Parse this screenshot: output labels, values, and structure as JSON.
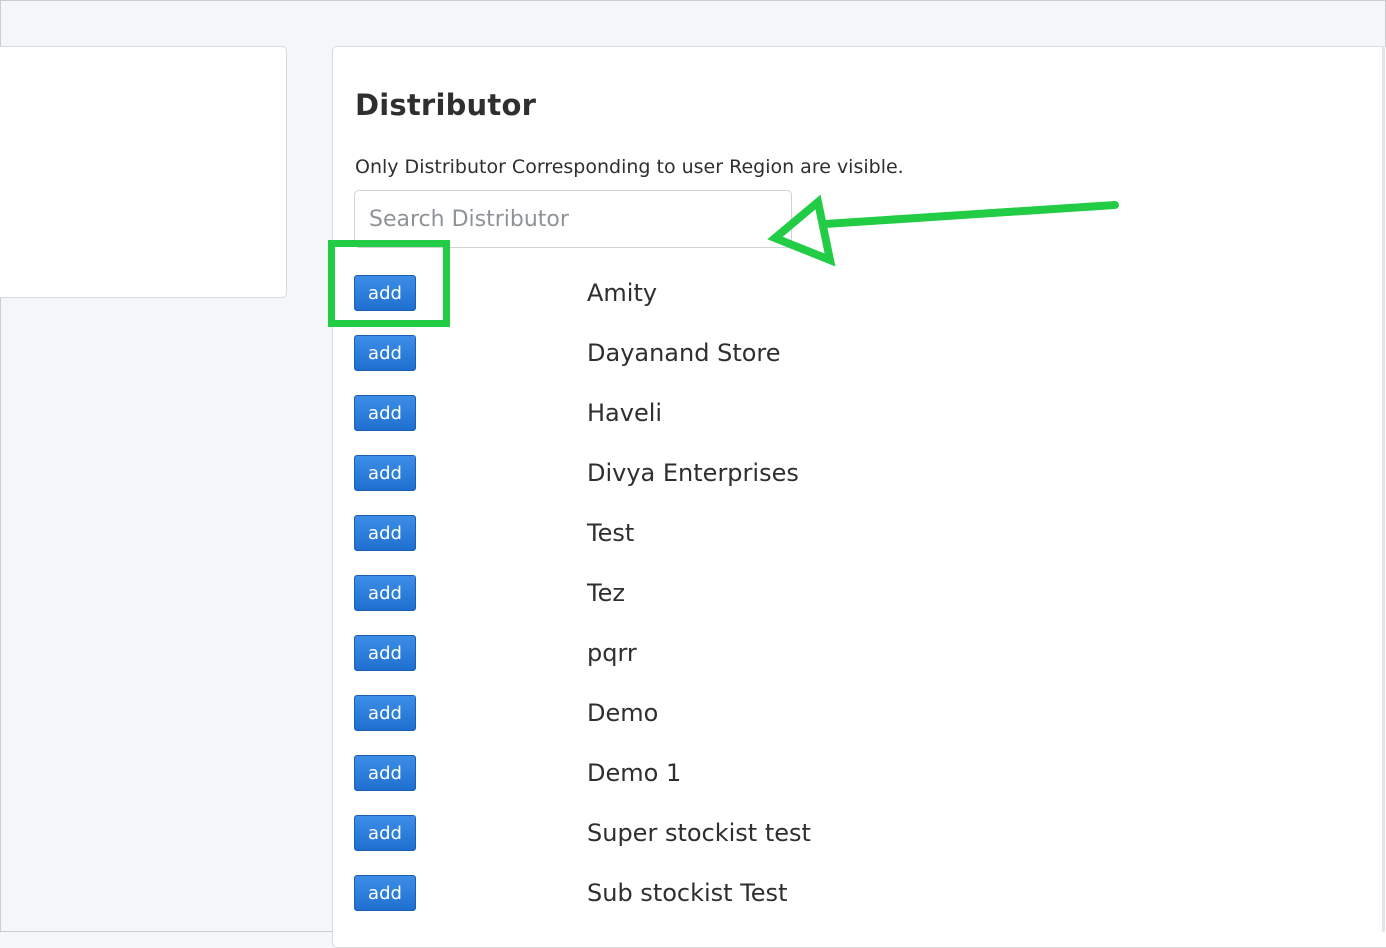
{
  "card": {
    "title": "Distributor",
    "notice": "Only Distributor Corresponding to user Region are visible."
  },
  "search": {
    "placeholder": "Search Distributor",
    "value": ""
  },
  "distributors": [
    {
      "button_label": "add",
      "name": "Amity"
    },
    {
      "button_label": "add",
      "name": "Dayanand Store"
    },
    {
      "button_label": "add",
      "name": "Haveli"
    },
    {
      "button_label": "add",
      "name": "Divya Enterprises"
    },
    {
      "button_label": "add",
      "name": "Test"
    },
    {
      "button_label": "add",
      "name": "Tez"
    },
    {
      "button_label": "add",
      "name": "pqrr"
    },
    {
      "button_label": "add",
      "name": "Demo"
    },
    {
      "button_label": "add",
      "name": "Demo 1"
    },
    {
      "button_label": "add",
      "name": "Super stockist test"
    },
    {
      "button_label": "add",
      "name": "Sub stockist Test"
    }
  ],
  "colors": {
    "button_blue": "#1f6fd0",
    "annotation_green": "#22cc44"
  }
}
